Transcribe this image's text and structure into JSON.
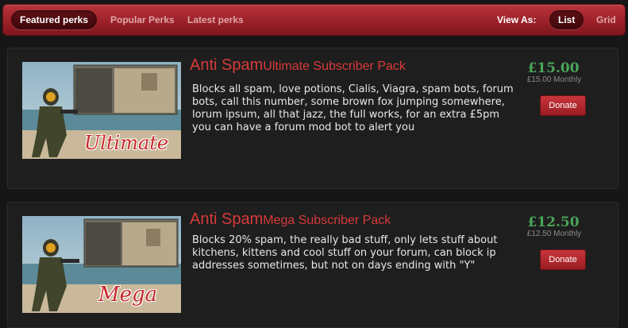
{
  "nav": {
    "tabs": [
      {
        "label": "Featured perks",
        "active": true
      },
      {
        "label": "Popular Perks",
        "active": false
      },
      {
        "label": "Latest perks",
        "active": false
      }
    ],
    "view_as_label": "View As:",
    "view_options": [
      {
        "label": "List",
        "active": true
      },
      {
        "label": "Grid",
        "active": false
      }
    ]
  },
  "perks": [
    {
      "title_main": "Anti Spam",
      "title_sub": "Ultimate Subscriber Pack",
      "image_caption": "Ultimate",
      "description": "Blocks all spam, love potions, Cialis, Viagra, spam bots, forum bots, call this number, some brown fox jumping somewhere, lorum ipsum, all that jazz, the full works, for an extra £5pm you can have a forum mod bot to alert you",
      "price": "£15.00",
      "monthly": "£15.00 Monthly",
      "button_label": "Donate"
    },
    {
      "title_main": "Anti Spam",
      "title_sub": "Mega Subscriber Pack",
      "image_caption": "Mega",
      "description": "Blocks 20% spam, the really bad stuff, only lets stuff about kitchens, kittens and cool stuff on your forum, can block ip addresses sometimes, but not on days ending with \"Y\"",
      "price": "£12.50",
      "monthly": "£12.50 Monthly",
      "button_label": "Donate"
    }
  ],
  "colors": {
    "accent": "#a0252d",
    "title": "#d83a3a",
    "price": "#4aa55a"
  }
}
